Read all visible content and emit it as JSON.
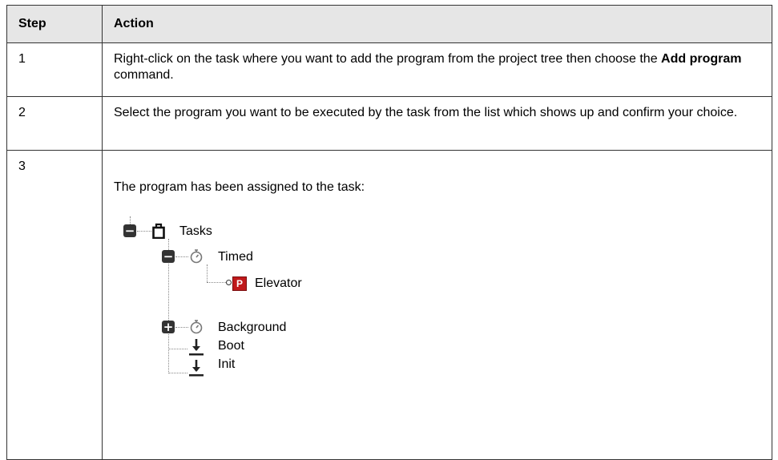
{
  "table": {
    "headers": [
      "Step",
      "Action"
    ],
    "rows": [
      {
        "step": "1",
        "text_before": "Right-click on the task where you want to add the program from the project tree then choose the ",
        "bold": "Add program",
        "text_after": " command."
      },
      {
        "step": "2",
        "text": "Select the program you want to be executed by the task from the list which shows up and confirm your choice."
      },
      {
        "step": "3",
        "text": "The program has been assigned to the task:"
      }
    ]
  },
  "tree": {
    "root": {
      "label": "Tasks",
      "icon": "task-folder-icon",
      "toggle": "−"
    },
    "timed": {
      "label": "Timed",
      "icon": "stopwatch-icon",
      "toggle": "−"
    },
    "elevator": {
      "label": "Elevator",
      "icon": "program-icon",
      "badge": "P"
    },
    "background": {
      "label": "Background",
      "icon": "stopwatch-icon",
      "toggle": "+"
    },
    "boot": {
      "label": "Boot",
      "icon": "download-arrow-icon"
    },
    "init": {
      "label": "Init",
      "icon": "download-arrow-icon"
    }
  }
}
